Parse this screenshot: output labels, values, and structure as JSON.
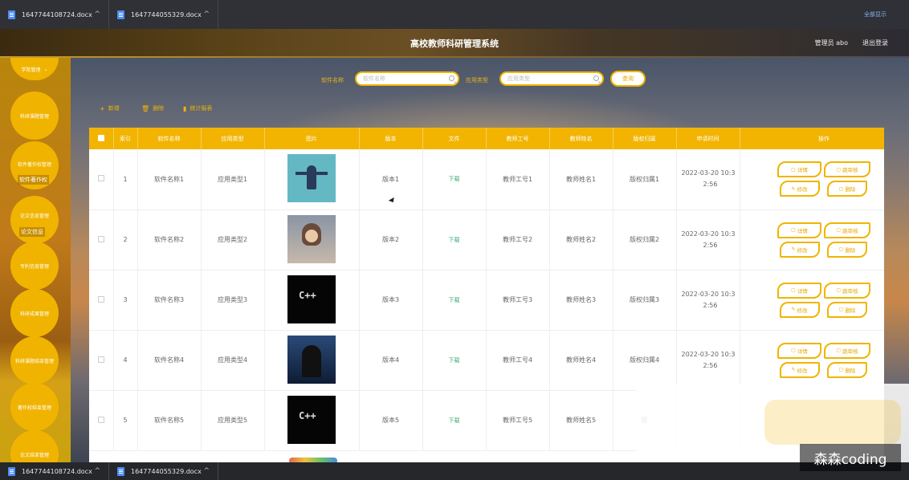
{
  "downloads": [
    {
      "name": "1647744108724.docx"
    },
    {
      "name": "1647744055329.docx"
    }
  ],
  "download_show_all": "全部显示",
  "header": {
    "title": "高校教师科研管理系统",
    "admin": "管理员 abo",
    "logout": "退出登录"
  },
  "sidebar": {
    "items": [
      {
        "label": "学院管理"
      },
      {
        "label": "科研课题管理"
      },
      {
        "label": "软件著作权管理"
      },
      {
        "label": "论文信息管理"
      },
      {
        "label": "专利信息管理"
      },
      {
        "label": "科研成果管理"
      },
      {
        "label": "科研课题结束管理"
      },
      {
        "label": "著作权结束管理"
      },
      {
        "label": "论文结束管理"
      }
    ],
    "sub_items": [
      {
        "label": "软件著作权"
      },
      {
        "label": "论文信息"
      }
    ]
  },
  "search": {
    "software_label": "软件名称",
    "software_placeholder": "软件名称",
    "type_label": "应用类型",
    "type_placeholder": "应用类型",
    "query_button": "查询"
  },
  "toolbar": {
    "add": "新增",
    "delete": "删除",
    "stats": "统计报表"
  },
  "table": {
    "headers": [
      "索引",
      "软件名称",
      "应用类型",
      "图片",
      "版本",
      "文件",
      "教师工号",
      "教师姓名",
      "版权归属",
      "申请时间",
      "操作"
    ],
    "rows": [
      {
        "index": "1",
        "name": "软件名称1",
        "type": "应用类型1",
        "image": "teal",
        "version": "版本1",
        "file": "下载",
        "teacher_id": "教师工号1",
        "teacher_name": "教师姓名1",
        "owner": "版权归属1",
        "time_line1": "2022-03-20 10:3",
        "time_line2": "2:56"
      },
      {
        "index": "2",
        "name": "软件名称2",
        "type": "应用类型2",
        "image": "girl",
        "version": "版本2",
        "file": "下载",
        "teacher_id": "教师工号2",
        "teacher_name": "教师姓名2",
        "owner": "版权归属2",
        "time_line1": "2022-03-20 10:3",
        "time_line2": "2:56"
      },
      {
        "index": "3",
        "name": "软件名称3",
        "type": "应用类型3",
        "image": "cpp",
        "version": "版本3",
        "file": "下载",
        "teacher_id": "教师工号3",
        "teacher_name": "教师姓名3",
        "owner": "版权归属3",
        "time_line1": "2022-03-20 10:3",
        "time_line2": "2:56"
      },
      {
        "index": "4",
        "name": "软件名称4",
        "type": "应用类型4",
        "image": "hood",
        "version": "版本4",
        "file": "下载",
        "teacher_id": "教师工号4",
        "teacher_name": "教师姓名4",
        "owner": "版权归属4",
        "time_line1": "2022-03-20 10:3",
        "time_line2": "2:56"
      },
      {
        "index": "5",
        "name": "软件名称5",
        "type": "应用类型5",
        "image": "cpp",
        "version": "版本5",
        "file": "下载",
        "teacher_id": "教师工号5",
        "teacher_name": "教师姓名5",
        "owner": "版",
        "time_line1": "",
        "time_line2": ""
      }
    ],
    "actions": {
      "detail": "详情",
      "review": "跳审核",
      "edit": "修改",
      "delete": "删除"
    }
  },
  "watermark": "森森coding",
  "colors": {
    "accent": "#f2b400",
    "download_link": "#3aa872"
  }
}
